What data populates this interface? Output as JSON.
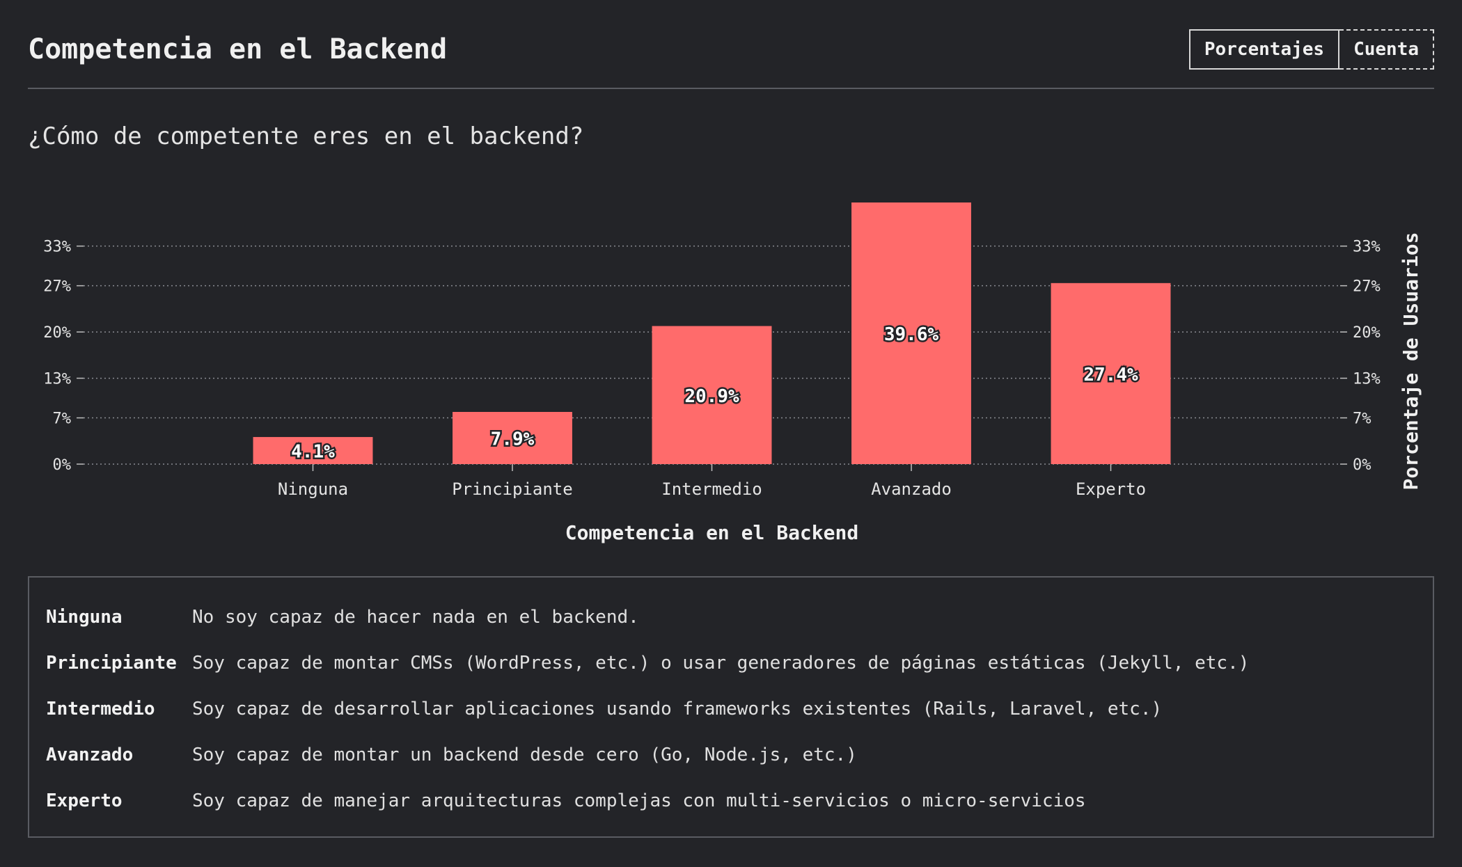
{
  "header": {
    "title": "Competencia en el Backend",
    "toggle": {
      "percent_label": "Porcentajes",
      "count_label": "Cuenta",
      "active": "percent"
    }
  },
  "question": "¿Cómo de competente eres en el backend?",
  "chart_data": {
    "type": "bar",
    "categories": [
      "Ninguna",
      "Principiante",
      "Intermedio",
      "Avanzado",
      "Experto"
    ],
    "values": [
      4.1,
      7.9,
      20.9,
      39.6,
      27.4
    ],
    "value_labels": [
      "4.1%",
      "7.9%",
      "20.9%",
      "39.6%",
      "27.4%"
    ],
    "xlabel": "Competencia en el Backend",
    "ylabel": "Porcentaje de Usuarios",
    "yticks": [
      0,
      7,
      13,
      20,
      27,
      33
    ],
    "ytick_labels": [
      "0%",
      "7%",
      "13%",
      "20%",
      "27%",
      "33%"
    ],
    "ylim": [
      0,
      39.6
    ],
    "grid": true,
    "bar_color": "#ff6b6b"
  },
  "legend": [
    {
      "term": "Ninguna",
      "description": "No soy capaz de hacer nada en el backend."
    },
    {
      "term": "Principiante",
      "description": "Soy capaz de montar CMSs (WordPress, etc.) o usar generadores de páginas estáticas (Jekyll, etc.)"
    },
    {
      "term": "Intermedio",
      "description": "Soy capaz de desarrollar aplicaciones usando frameworks existentes (Rails, Laravel, etc.)"
    },
    {
      "term": "Avanzado",
      "description": "Soy capaz de montar un backend desde cero (Go, Node.js, etc.)"
    },
    {
      "term": "Experto",
      "description": "Soy capaz de manejar arquitecturas complejas con multi-servicios o micro-servicios"
    }
  ]
}
